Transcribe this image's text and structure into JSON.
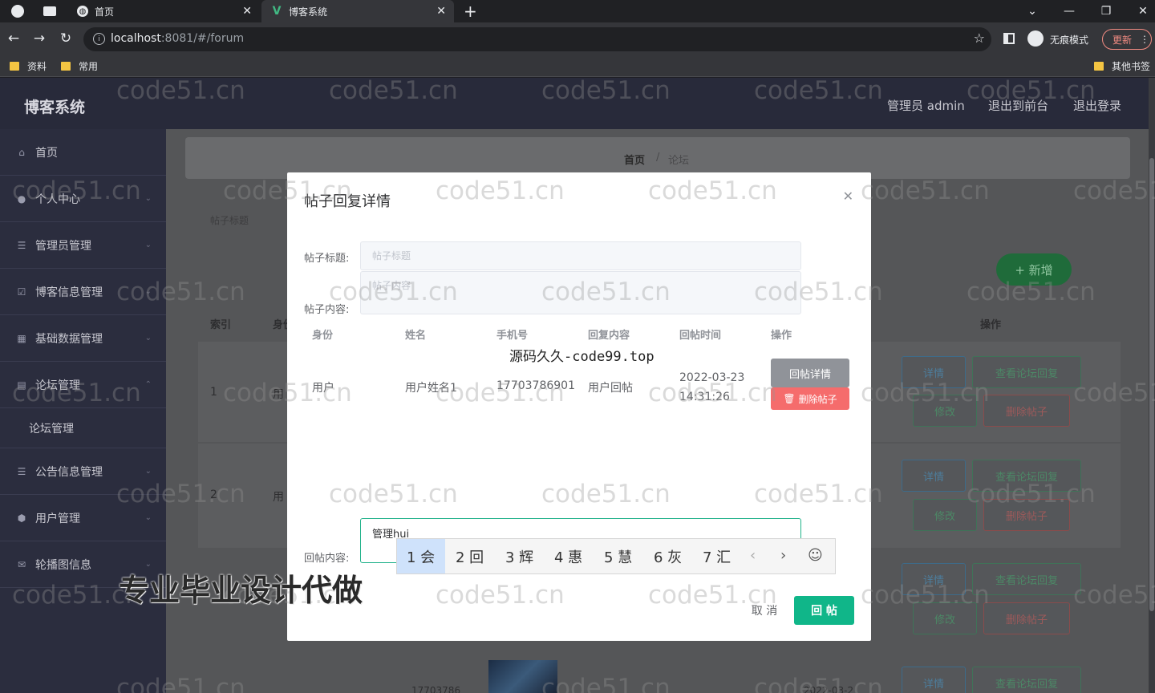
{
  "browser": {
    "tabs": [
      {
        "title": "首页"
      },
      {
        "title": "博客系统"
      }
    ],
    "new_tab": "+",
    "url_host": "localhost",
    "url_rest": ":8081/#/forum",
    "incognito_label": "无痕模式",
    "update_label": "更新",
    "bookmarks": [
      "资料",
      "常用"
    ],
    "other_bookmarks": "其他书签"
  },
  "header": {
    "title": "博客系统",
    "admin_label": "管理员 admin",
    "back_front": "退出到前台",
    "logout": "退出登录"
  },
  "sidebar": {
    "items": [
      {
        "label": "首页",
        "icon": "home-icon"
      },
      {
        "label": "个人中心",
        "icon": "user-icon"
      },
      {
        "label": "管理员管理",
        "icon": "list-icon"
      },
      {
        "label": "博客信息管理",
        "icon": "check-icon"
      },
      {
        "label": "基础数据管理",
        "icon": "grid-icon"
      },
      {
        "label": "论坛管理",
        "icon": "table-icon"
      },
      {
        "label": "论坛管理",
        "icon": ""
      },
      {
        "label": "公告信息管理",
        "icon": "list-icon"
      },
      {
        "label": "用户管理",
        "icon": "shield-icon"
      },
      {
        "label": "轮播图信息",
        "icon": "mail-icon"
      }
    ]
  },
  "main": {
    "breadcrumb": [
      "首页",
      "/",
      "论坛"
    ],
    "sub_label": "帖子标题",
    "add_button": "+ 新增",
    "columns": [
      "索引",
      "身份",
      "操作"
    ],
    "rows": [
      {
        "index": "1",
        "name": "用"
      },
      {
        "index": "2",
        "name": "用"
      },
      {
        "index": "3",
        "name": ""
      }
    ],
    "row_buttons": {
      "detail": "详情",
      "view_reply": "查看论坛回复",
      "edit": "修改",
      "delete": "删除帖子"
    },
    "phone_partial": "17703786",
    "date_partial": "2022-03-2"
  },
  "dialog": {
    "title": "帖子回复详情",
    "title_label": "帖子标题:",
    "title_placeholder": "帖子标题",
    "content_label": "帖子内容:",
    "content_placeholder": "帖子内容",
    "columns": [
      "身份",
      "姓名",
      "手机号",
      "回复内容",
      "回帖时间",
      "操作"
    ],
    "reply_row": {
      "identity": "用户",
      "name": "用户姓名1",
      "phone": "17703786901",
      "content": "用户回帖",
      "time": "2022-03-23 14:31:26"
    },
    "detail_button": "回帖详情",
    "delete_button": "删除帖子",
    "reply_label": "回帖内容:",
    "reply_value": "管理hui",
    "cancel_button": "取 消",
    "submit_button": "回 帖"
  },
  "ime": {
    "candidates": [
      "1 会",
      "2 回",
      "3 辉",
      "4 惠",
      "5 慧",
      "6 灰",
      "7 汇"
    ],
    "prev": "‹",
    "next": "›",
    "emoji": "☺"
  },
  "watermark": {
    "site": "code51.cn",
    "source": "源码久久-code99.top",
    "promo": "专业毕业设计代做"
  },
  "colors": {
    "primary_green": "#10b689",
    "danger": "#f56c6c",
    "sidebar_bg": "#2b2d3e"
  }
}
